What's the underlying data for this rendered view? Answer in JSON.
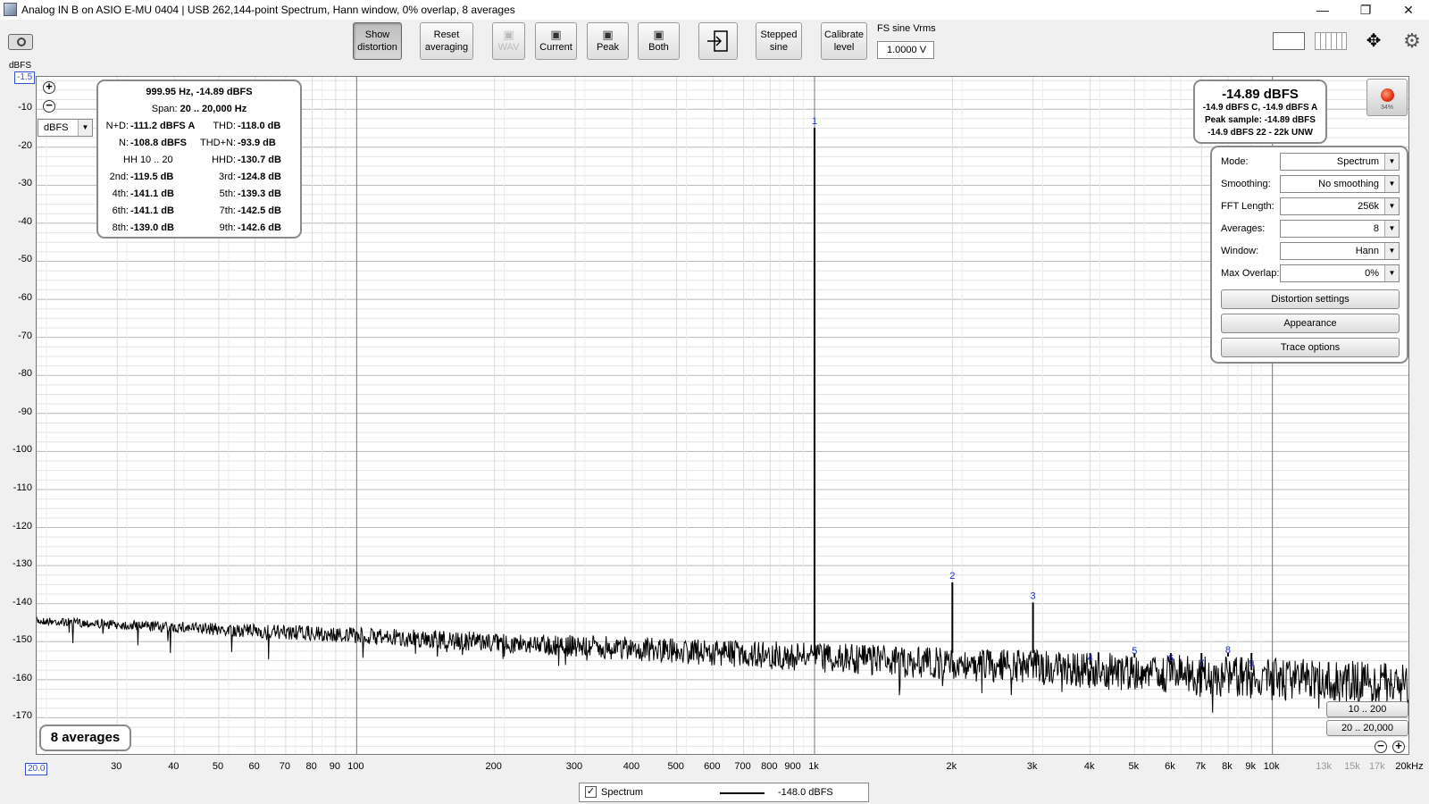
{
  "window": {
    "title": "Analog IN B on ASIO E-MU 0404 | USB 262,144-point Spectrum, Hann window, 0% overlap, 8 averages",
    "minimize": "—",
    "restore": "❐",
    "close": "✕"
  },
  "toolbar": {
    "show_distortion": [
      "Show",
      "distortion"
    ],
    "reset_averaging": [
      "Reset",
      "averaging"
    ],
    "wav": "WAV",
    "current": "Current",
    "peak": "Peak",
    "both": "Both",
    "stepped_sine": [
      "Stepped",
      "sine"
    ],
    "calibrate_level": [
      "Calibrate",
      "level"
    ],
    "fs_label": "FS sine Vrms",
    "fs_value": "1.0000 V"
  },
  "y_axis": {
    "unit": "dBFS",
    "top_edge": "-1.5",
    "ticks": [
      "-10",
      "-20",
      "-30",
      "-40",
      "-50",
      "-60",
      "-70",
      "-80",
      "-90",
      "-100",
      "-110",
      "-120",
      "-130",
      "-140",
      "-150",
      "-160",
      "-170"
    ],
    "unit_select": "dBFS"
  },
  "x_axis": {
    "left_edge": "20.0",
    "ticks": [
      {
        "label": "30",
        "hz": 30
      },
      {
        "label": "40",
        "hz": 40
      },
      {
        "label": "50",
        "hz": 50
      },
      {
        "label": "60",
        "hz": 60
      },
      {
        "label": "70",
        "hz": 70
      },
      {
        "label": "80",
        "hz": 80
      },
      {
        "label": "90",
        "hz": 90
      },
      {
        "label": "100",
        "hz": 100
      },
      {
        "label": "200",
        "hz": 200
      },
      {
        "label": "300",
        "hz": 300
      },
      {
        "label": "400",
        "hz": 400
      },
      {
        "label": "500",
        "hz": 500
      },
      {
        "label": "600",
        "hz": 600
      },
      {
        "label": "700",
        "hz": 700
      },
      {
        "label": "800",
        "hz": 800
      },
      {
        "label": "900",
        "hz": 900
      },
      {
        "label": "1k",
        "hz": 1000
      },
      {
        "label": "2k",
        "hz": 2000
      },
      {
        "label": "3k",
        "hz": 3000
      },
      {
        "label": "4k",
        "hz": 4000
      },
      {
        "label": "5k",
        "hz": 5000
      },
      {
        "label": "6k",
        "hz": 6000
      },
      {
        "label": "7k",
        "hz": 7000
      },
      {
        "label": "8k",
        "hz": 8000
      },
      {
        "label": "9k",
        "hz": 9000
      },
      {
        "label": "10k",
        "hz": 10000
      }
    ],
    "dim_ticks": [
      {
        "label": "13k",
        "hz": 13000
      },
      {
        "label": "15k",
        "hz": 15000
      },
      {
        "label": "17k",
        "hz": 17000
      }
    ],
    "end_label": "20kHz"
  },
  "distortion": {
    "header": "999.95 Hz, -14.89 dBFS",
    "span_label": "Span:",
    "span_value": "20 .. 20,000 Hz",
    "rows": [
      {
        "l_lbl": "N+D:",
        "l_val": "-111.2 dBFS A",
        "r_lbl": "THD:",
        "r_val": "-118.0 dB"
      },
      {
        "l_lbl": "N:",
        "l_val": "-108.8 dBFS",
        "r_lbl": "THD+N:",
        "r_val": "-93.9 dB"
      },
      {
        "l_lbl": "HH 10 .. 20",
        "l_val": "",
        "r_lbl": "HHD:",
        "r_val": "-130.7 dB"
      },
      {
        "l_lbl": "2nd:",
        "l_val": "-119.5 dB",
        "r_lbl": "3rd:",
        "r_val": "-124.8 dB"
      },
      {
        "l_lbl": "4th:",
        "l_val": "-141.1 dB",
        "r_lbl": "5th:",
        "r_val": "-139.3 dB"
      },
      {
        "l_lbl": "6th:",
        "l_val": "-141.1 dB",
        "r_lbl": "7th:",
        "r_val": "-142.5 dB"
      },
      {
        "l_lbl": "8th:",
        "l_val": "-139.0 dB",
        "r_lbl": "9th:",
        "r_val": "-142.6 dB"
      }
    ]
  },
  "level": {
    "main": "-14.89 dBFS",
    "line1": "-14.9 dBFS C, -14.9 dBFS A",
    "line2": "Peak sample: -14.89 dBFS",
    "line3": "-14.9 dBFS 22 - 22k UNW",
    "record_pct": "34%"
  },
  "controls": {
    "rows": [
      {
        "label": "Mode:",
        "value": "Spectrum"
      },
      {
        "label": "Smoothing:",
        "value": "No  smoothing"
      },
      {
        "label": "FFT Length:",
        "value": "256k"
      },
      {
        "label": "Averages:",
        "value": "8"
      },
      {
        "label": "Window:",
        "value": "Hann"
      },
      {
        "label": "Max Overlap:",
        "value": "0%"
      }
    ],
    "distortion_settings": "Distortion settings",
    "appearance": "Appearance",
    "trace_options": "Trace options"
  },
  "averages_badge": "8 averages",
  "span_buttons": [
    "10 .. 200",
    "20 .. 20,000"
  ],
  "legend": {
    "checked": "✓",
    "name": "Spectrum",
    "value": "-148.0 dBFS"
  },
  "harmonics": [
    {
      "label": "1",
      "hz": 1000,
      "db": -14.9
    },
    {
      "label": "2",
      "hz": 2000,
      "db": -134.4
    },
    {
      "label": "3",
      "hz": 3000,
      "db": -139.7
    },
    {
      "label": "4",
      "hz": 4000,
      "db": -156.0
    },
    {
      "label": "5",
      "hz": 5000,
      "db": -154.2
    },
    {
      "label": "6",
      "hz": 6000,
      "db": -156.0
    },
    {
      "label": "7",
      "hz": 7000,
      "db": -157.4
    },
    {
      "label": "8",
      "hz": 8000,
      "db": -153.9
    },
    {
      "label": "9",
      "hz": 9000,
      "db": -157.5
    }
  ],
  "colors": {
    "trace": "#000000",
    "harmonic_label": "#2030c0",
    "grid": "#d8d8d8",
    "grid_major": "#a0a0a0"
  }
}
